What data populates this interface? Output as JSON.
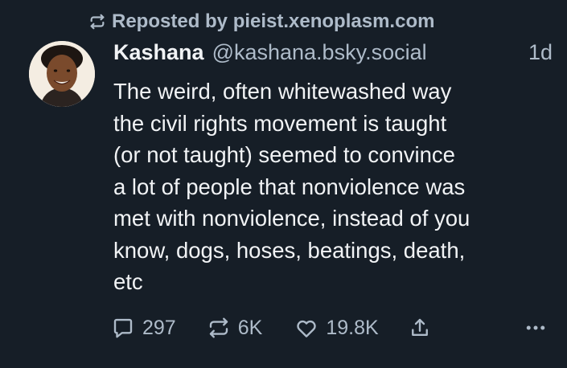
{
  "repost": {
    "label": "Reposted by pieist.xenoplasm.com",
    "icon": "repost-icon"
  },
  "post": {
    "author_name": "Kashana",
    "author_handle": "@kashana.bsky.social",
    "time": "1d",
    "text": "The weird, often whitewashed way\nthe civil rights movement is taught\n(or not taught) seemed to convince\na lot of people that nonviolence was\nmet with nonviolence, instead of you\nknow, dogs, hoses, beatings, death,\netc"
  },
  "actions": {
    "reply_count": "297",
    "repost_count": "6K",
    "like_count": "19.8K",
    "icons": [
      "reply-icon",
      "repost-icon",
      "heart-icon",
      "share-icon",
      "more-icon"
    ]
  },
  "colors": {
    "background": "#161e27",
    "text": "#f1f3f5",
    "muted": "#aebbc9"
  }
}
